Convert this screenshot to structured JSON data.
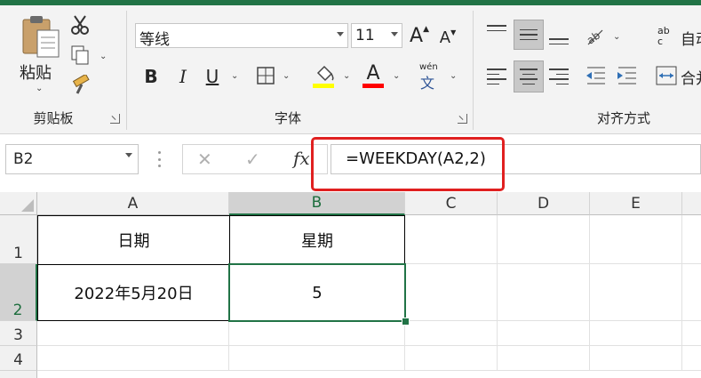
{
  "clipboard": {
    "paste_label": "粘贴",
    "group_label": "剪贴板"
  },
  "font": {
    "name": "等线",
    "size": "11",
    "grow_label": "A",
    "shrink_label": "A",
    "bold_label": "B",
    "italic_label": "I",
    "underline_label": "U",
    "font_color_label": "A",
    "phonetic_top": "wén",
    "phonetic_bottom": "文",
    "group_label": "字体",
    "fill_color": "#ffff00",
    "text_color": "#ff0000"
  },
  "alignment": {
    "orient_top": "ab",
    "orient_bottom": "c",
    "wrap_label": "自动",
    "merge_label": "合并",
    "group_label": "对齐方式"
  },
  "formula_bar": {
    "name_box": "B2",
    "cancel_symbol": "✕",
    "enter_symbol": "✓",
    "fx_label": "fx",
    "formula": "=WEEKDAY(A2,2)"
  },
  "grid": {
    "columns": [
      "A",
      "B",
      "C",
      "D",
      "E"
    ],
    "rows": [
      "1",
      "2",
      "3",
      "4"
    ],
    "cells": {
      "A1": "日期",
      "B1": "星期",
      "A2": "2022年5月20日",
      "B2": "5"
    },
    "accent_color": "#217346"
  }
}
